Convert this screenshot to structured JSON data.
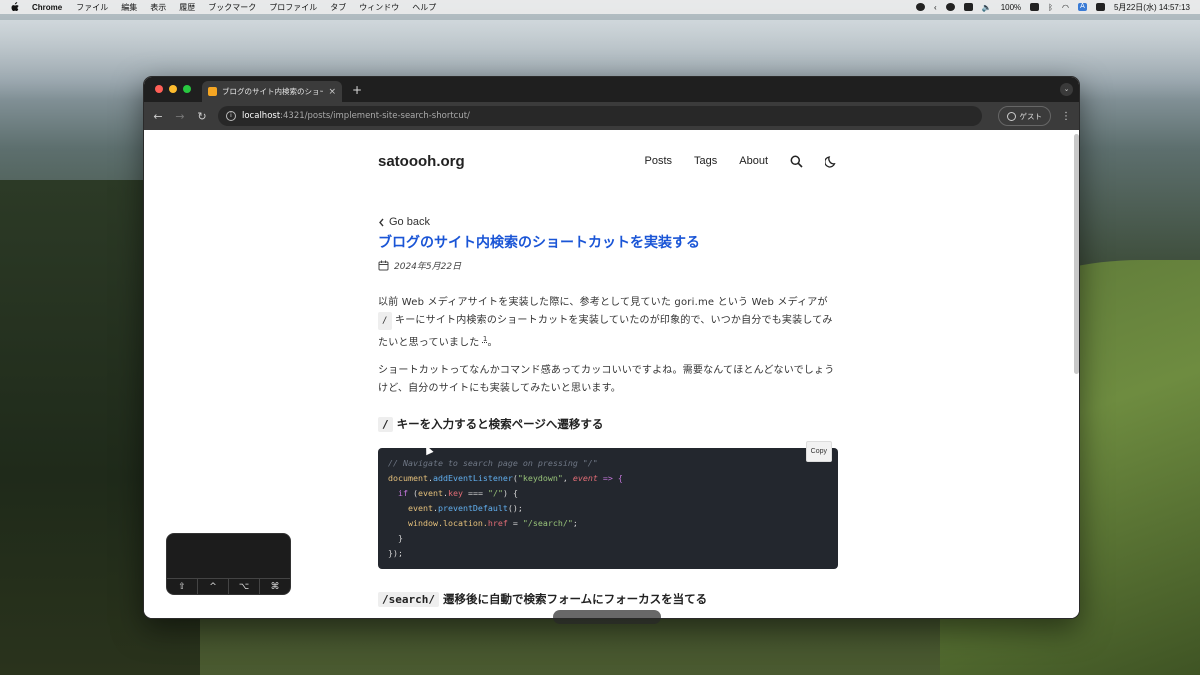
{
  "menubar": {
    "app_name": "Chrome",
    "items": [
      "ファイル",
      "編集",
      "表示",
      "履歴",
      "ブックマーク",
      "プロファイル",
      "タブ",
      "ウィンドウ",
      "ヘルプ"
    ],
    "battery": "100%",
    "datetime": "5月22日(水) 14:57:13",
    "input_indicator": "A"
  },
  "browser": {
    "tab_title": "ブログのサイト内検索のショート",
    "new_tab": "+",
    "url_host": "localhost",
    "url_path": ":4321/posts/implement-site-search-shortcut/",
    "profile_label": "ゲスト"
  },
  "site": {
    "brand": "satoooh.org",
    "nav": [
      "Posts",
      "Tags",
      "About"
    ]
  },
  "post": {
    "back_label": "Go back",
    "title": "ブログのサイト内検索のショートカットを実装する",
    "date": "2024年5月22日",
    "para1_a": "以前 Web メディアサイトを実装した際に、参考として見ていた gori.me という Web メディアが",
    "para1_key": "/",
    "para1_b": "キーにサイト内検索のショートカットを実装していたのが印象的で、いつか自分でも実装してみたいと思っていました",
    "para1_fn": "1",
    "para1_end": "。",
    "para2": "ショートカットってなんかコマンド感あってカッコいいですよね。需要なんてほとんどないでしょうけど、自分のサイトにも実装してみたいと思います。",
    "h2_1_code": "/",
    "h2_1_text": "キーを入力すると検索ページへ遷移する",
    "copy_label": "Copy",
    "h2_2_code": "/search/",
    "h2_2_text": "遷移後に自動で検索フォームにフォーカスを当てる"
  },
  "code": {
    "comment": "// Navigate to search page on pressing \"/\"",
    "l2_obj": "document",
    "l2_dot": ".",
    "l2_fn": "addEventListener",
    "l2_open": "(",
    "l2_str": "\"keydown\"",
    "l2_comma": ", ",
    "l2_param": "event",
    "l2_arrow": " => {",
    "l3_indent": "  ",
    "l3_kw": "if",
    "l3_a": " (",
    "l3_obj": "event",
    "l3_dot": ".",
    "l3_prop": "key",
    "l3_op": " === ",
    "l3_str": "\"/\"",
    "l3_end": ") {",
    "l4_indent": "    ",
    "l4_obj": "event",
    "l4_dot": ".",
    "l4_fn": "preventDefault",
    "l4_end": "();",
    "l5_indent": "    ",
    "l5_obj": "window",
    "l5_a": ".location.",
    "l5_prop": "href",
    "l5_op": " = ",
    "l5_str": "\"/search/\"",
    "l5_end": ";",
    "l6": "  }",
    "l7": "});"
  },
  "keyboard_overlay": {
    "keys": [
      "⇧",
      "^",
      "⌥",
      "⌘"
    ]
  },
  "colors": {
    "title_link": "#1a55d6",
    "code_bg": "#23272e"
  }
}
